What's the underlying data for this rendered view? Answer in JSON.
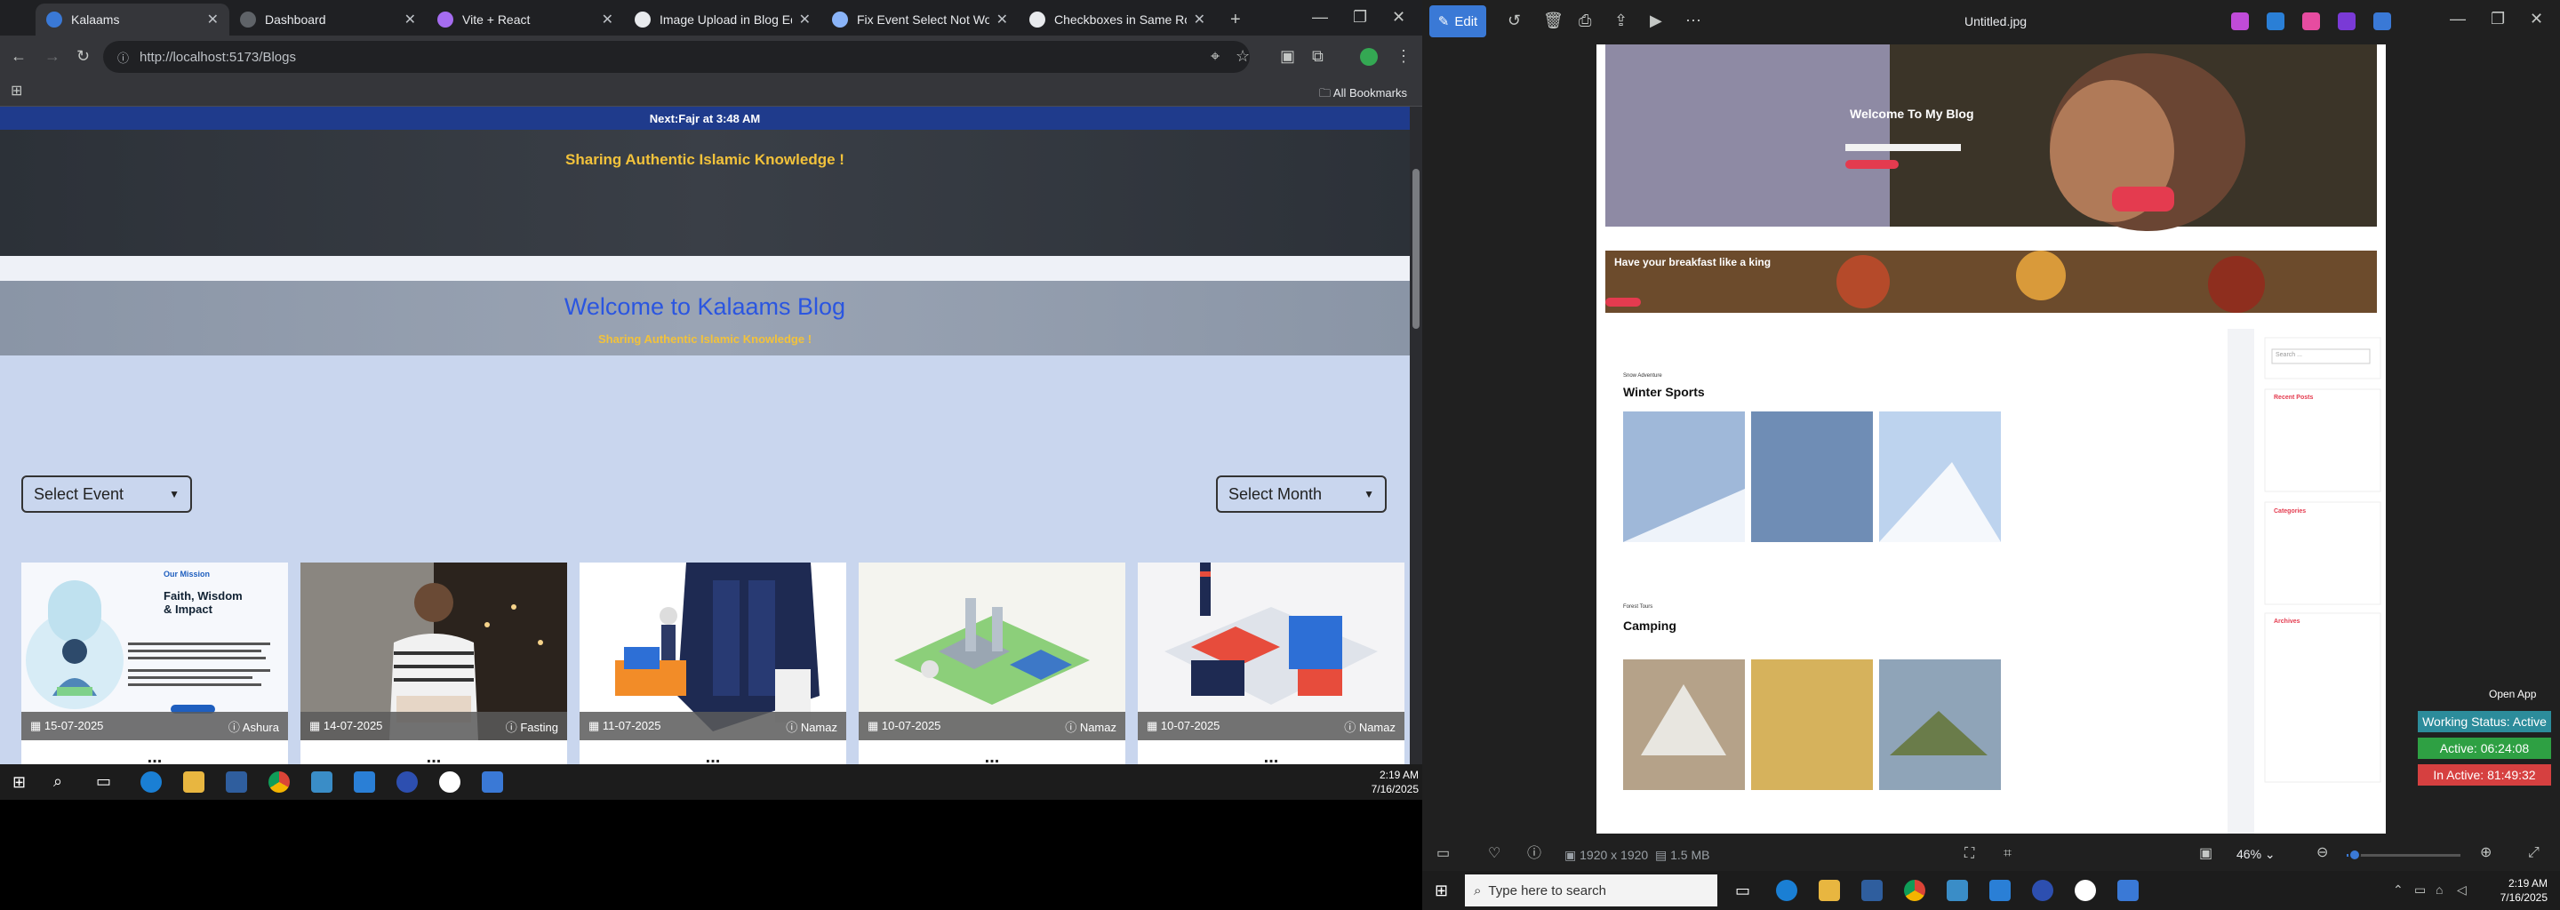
{
  "browser": {
    "tabs": [
      {
        "title": "Kalaams",
        "active": true
      },
      {
        "title": "Dashboard",
        "active": false
      },
      {
        "title": "Vite + React",
        "active": false
      },
      {
        "title": "Image Upload in Blog Editor",
        "active": false
      },
      {
        "title": "Fix Event Select Not Working",
        "active": false
      },
      {
        "title": "Checkboxes in Same Row",
        "active": false
      }
    ],
    "url": "http://localhost:5173/Blogs",
    "bookmarks_label": "All Bookmarks"
  },
  "site": {
    "top_banner_prefix": "Next: ",
    "top_banner_bold": "Fajr",
    "top_banner_suffix": " at 3:48 AM",
    "hero_tagline": "Sharing Authentic Islamic Knowledge !",
    "welcome_title": "Welcome to Kalaams Blog",
    "welcome_sub": "Sharing Authentic Islamic Knowledge !",
    "select_event": "Select Event",
    "select_month": "Select Month",
    "cards": [
      {
        "date": "15-07-2025",
        "category": "Ashura",
        "title": "...",
        "image": "mission"
      },
      {
        "date": "14-07-2025",
        "category": "Fasting",
        "title": "...",
        "image": "person"
      },
      {
        "date": "11-07-2025",
        "category": "Namaz",
        "title": "...",
        "image": "office"
      },
      {
        "date": "10-07-2025",
        "category": "Namaz",
        "title": "...",
        "image": "factory"
      },
      {
        "date": "10-07-2025",
        "category": "Namaz",
        "title": "...",
        "image": "building"
      }
    ],
    "mission_card": {
      "kicker": "Our Mission",
      "heading": "Faith, Wisdom & Impact"
    }
  },
  "taskbar_left": {
    "time": "2:19 AM",
    "date": "7/16/2025"
  },
  "photos": {
    "edit_label": "Edit",
    "file_name": "Untitled.jpg",
    "dimensions": "1920 x 1920",
    "file_size": "1.5 MB",
    "zoom": "46%",
    "zoom_level": 0.07,
    "open_app": "Open App",
    "working_status": "Working Status: Active",
    "active_time": "Active: 06:24:08",
    "inactive_time": "In Active: 81:49:32",
    "preview": {
      "hero_title": "Welcome To My Blog",
      "strip_title": "Have your breakfast like a king",
      "section1_kicker": "Snow Adventure",
      "section1_title": "Winter Sports",
      "section2_kicker": "Forest Tours",
      "section2_title": "Camping",
      "search_placeholder": "Search ...",
      "recent_posts": "Recent Posts",
      "categories": "Categories",
      "archives": "Archives"
    }
  },
  "taskbar_right": {
    "search_placeholder": "Type here to search",
    "time": "2:19 AM",
    "date": "7/16/2025"
  },
  "colors": {
    "accent_blue": "#2b56e0",
    "gold": "#f2c23b",
    "banner": "#1f3b8c"
  }
}
